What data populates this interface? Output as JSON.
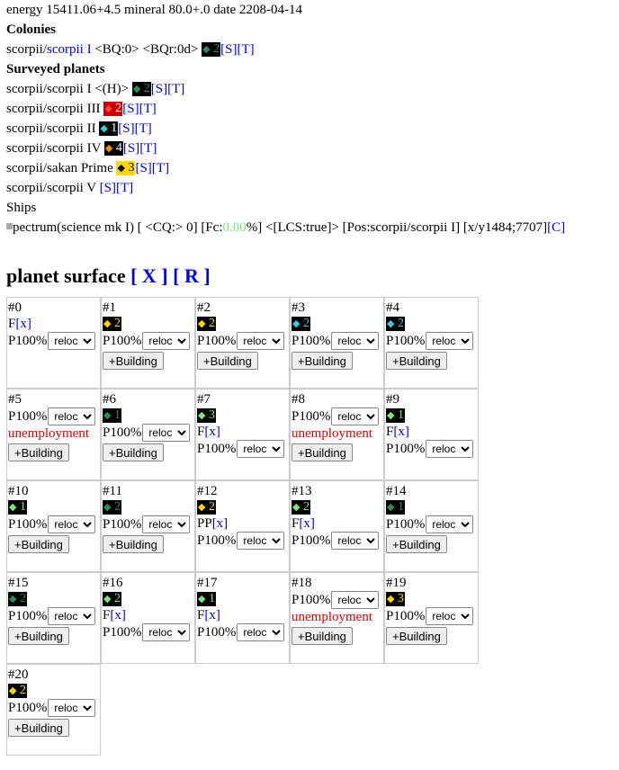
{
  "status": {
    "text": "energy 15411.06+4.5 mineral 80.0+.0 date 2208-04-14"
  },
  "colonies": {
    "heading": "Colonies",
    "items": [
      {
        "prefix": "scorpii/",
        "name": "scorpii I",
        "tags": " <BQ:0> <BQr:0d> ",
        "badge": {
          "color": "#2e8b57",
          "num": "2"
        },
        "s": "[S]",
        "t": "[T]"
      }
    ]
  },
  "surveyed": {
    "heading": "Surveyed planets",
    "items": [
      {
        "text": "scorpii/scorpii I <(H)> ",
        "badge": {
          "color": "#2e8b57",
          "num": "2",
          "bg": "#000"
        },
        "s": "[S]",
        "t": "[T]"
      },
      {
        "text": "scorpii/scorpii III ",
        "badge": {
          "color": "#ffffff",
          "num": "2",
          "bg": "#cc0000",
          "diam": "#ff4040"
        },
        "s": "[S]",
        "t": "[T]"
      },
      {
        "text": "scorpii/scorpii II ",
        "badge": {
          "color": "#ffffff",
          "num": "1",
          "bg": "#000",
          "diam": "#40c8e0"
        },
        "s": "[S]",
        "t": "[T]"
      },
      {
        "text": "scorpii/scorpii IV ",
        "badge": {
          "color": "#ffffff",
          "num": "4",
          "bg": "#000",
          "diam": "#ff8c00"
        },
        "s": "[S]",
        "t": "[T]"
      },
      {
        "text": "scorpii/sakan Prime ",
        "badge": {
          "color": "#000",
          "num": "3",
          "bg": "#ffd700",
          "diam": "#000"
        },
        "s": "[S]",
        "t": "[T]"
      },
      {
        "text": "scorpii/scorpii V ",
        "badge": null,
        "s": "[S]",
        "t": "[T]"
      }
    ]
  },
  "ships": {
    "heading": "Ships",
    "ship": {
      "pre": "pectrum(science mk I) [ <CQ:> 0] [Fc:",
      "fc": "0.00",
      "post": "%] <[LCS:true]> [Pos:scorpii/scorpii I] [x/y1484;7707]",
      "c": "[C]"
    }
  },
  "surface": {
    "title": "planet surface ",
    "x": "[ X ]",
    "r": "[ R ]",
    "p_label": "P100%",
    "select_value": "reloc",
    "build_label": "+Building",
    "unemp": "unemployment",
    "fx": "[x]",
    "cells": [
      {
        "id": "#0",
        "badge": null,
        "f": "F",
        "p": true,
        "unemp": false,
        "build": false
      },
      {
        "id": "#1",
        "badge": {
          "num": "2",
          "bg": "#000",
          "fg": "#ffd700",
          "diam": "#ffd700"
        },
        "p": true,
        "build": true
      },
      {
        "id": "#2",
        "badge": {
          "num": "2",
          "bg": "#000",
          "fg": "#ffd700",
          "diam": "#ffd700"
        },
        "p": true,
        "build": true
      },
      {
        "id": "#3",
        "badge": {
          "num": "2",
          "bg": "#000",
          "fg": "#40c8e0",
          "diam": "#40c8e0"
        },
        "p": true,
        "build": true
      },
      {
        "id": "#4",
        "badge": {
          "num": "2",
          "bg": "#000",
          "fg": "#40c8e0",
          "diam": "#40c8e0"
        },
        "p": true,
        "build": true
      },
      {
        "id": "#5",
        "badge": null,
        "p": true,
        "unemp": true,
        "build": true
      },
      {
        "id": "#6",
        "badge": {
          "num": "1",
          "bg": "#000",
          "fg": "#2e8b57",
          "diam": "#2e8b57"
        },
        "p": true,
        "build": true
      },
      {
        "id": "#7",
        "badge": {
          "num": "3",
          "bg": "#000",
          "fg": "#7be57b",
          "diam": "#7be57b"
        },
        "f": "F",
        "p": true
      },
      {
        "id": "#8",
        "badge": null,
        "p": true,
        "unemp": true,
        "build": true
      },
      {
        "id": "#9",
        "badge": {
          "num": "1",
          "bg": "#000",
          "fg": "#7be57b",
          "diam": "#7be57b"
        },
        "f": "F",
        "p": true
      },
      {
        "id": "#10",
        "badge": {
          "num": "1",
          "bg": "#000",
          "fg": "#7be57b",
          "diam": "#7be57b"
        },
        "p": true,
        "build": true
      },
      {
        "id": "#11",
        "badge": {
          "num": "2",
          "bg": "#000",
          "fg": "#2e8b57",
          "diam": "#2e8b57"
        },
        "p": true,
        "build": true
      },
      {
        "id": "#12",
        "badge": {
          "num": "2",
          "bg": "#000",
          "fg": "#ffd700",
          "diam": "#ffd700"
        },
        "f": "PP",
        "p": true
      },
      {
        "id": "#13",
        "badge": {
          "num": "2",
          "bg": "#000",
          "fg": "#7be57b",
          "diam": "#7be57b"
        },
        "f": "F",
        "p": true
      },
      {
        "id": "#14",
        "badge": {
          "num": "1",
          "bg": "#000",
          "fg": "#2e8b57",
          "diam": "#2e8b57"
        },
        "p": true,
        "build": true
      },
      {
        "id": "#15",
        "badge": {
          "num": "2",
          "bg": "#000",
          "fg": "#2e8b57",
          "diam": "#2e8b57"
        },
        "p": true,
        "build": true
      },
      {
        "id": "#16",
        "badge": {
          "num": "2",
          "bg": "#000",
          "fg": "#7be57b",
          "diam": "#7be57b"
        },
        "f": "F",
        "p": true
      },
      {
        "id": "#17",
        "badge": {
          "num": "1",
          "bg": "#000",
          "fg": "#7be57b",
          "diam": "#7be57b"
        },
        "f": "F",
        "p": true
      },
      {
        "id": "#18",
        "badge": null,
        "p": true,
        "unemp": true,
        "build": true
      },
      {
        "id": "#19",
        "badge": {
          "num": "3",
          "bg": "#000",
          "fg": "#ffd700",
          "diam": "#ffd700"
        },
        "p": true,
        "build": true
      },
      {
        "id": "#20",
        "badge": {
          "num": "2",
          "bg": "#000",
          "fg": "#ffd700",
          "diam": "#ffd700"
        },
        "p": true,
        "build": true
      }
    ]
  }
}
